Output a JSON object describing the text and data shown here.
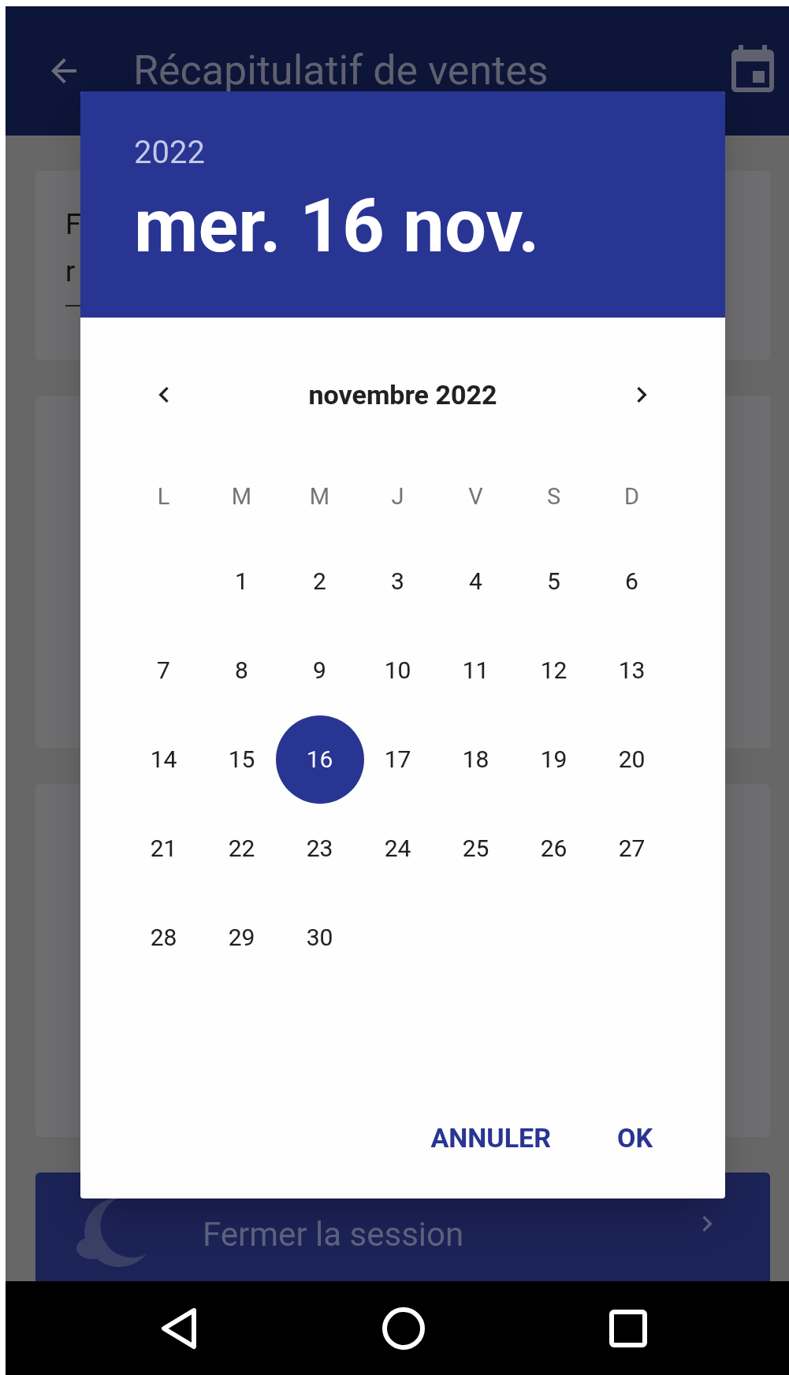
{
  "app_bar": {
    "title": "Récapitulatif de ventes"
  },
  "summary_card": {
    "lines": [
      "F",
      "r"
    ]
  },
  "session_button": {
    "label": "Fermer la session"
  },
  "date_picker": {
    "year": "2022",
    "date": "mer. 16 nov.",
    "month": "novembre 2022",
    "weekdays": [
      "L",
      "M",
      "M",
      "J",
      "V",
      "S",
      "D"
    ],
    "weeks": [
      [
        {
          "label": "1",
          "selected": false
        },
        {
          "label": "2",
          "selected": false
        },
        {
          "label": "3",
          "selected": false
        },
        {
          "label": "4",
          "selected": false
        },
        {
          "label": "5",
          "selected": false
        },
        {
          "label": "6",
          "selected": false
        }
      ],
      [
        {
          "label": "7",
          "selected": false
        },
        {
          "label": "8",
          "selected": false
        },
        {
          "label": "9",
          "selected": false
        },
        {
          "label": "10",
          "selected": false
        },
        {
          "label": "11",
          "selected": false
        },
        {
          "label": "12",
          "selected": false
        },
        {
          "label": "13",
          "selected": false
        }
      ],
      [
        {
          "label": "14",
          "selected": false
        },
        {
          "label": "15",
          "selected": false
        },
        {
          "label": "16",
          "selected": true
        },
        {
          "label": "17",
          "selected": false
        },
        {
          "label": "18",
          "selected": false
        },
        {
          "label": "19",
          "selected": false
        },
        {
          "label": "20",
          "selected": false
        }
      ],
      [
        {
          "label": "21",
          "selected": false
        },
        {
          "label": "22",
          "selected": false
        },
        {
          "label": "23",
          "selected": false
        },
        {
          "label": "24",
          "selected": false
        },
        {
          "label": "25",
          "selected": false
        },
        {
          "label": "26",
          "selected": false
        },
        {
          "label": "27",
          "selected": false
        }
      ],
      [
        {
          "label": "28",
          "selected": false
        },
        {
          "label": "29",
          "selected": false
        },
        {
          "label": "30",
          "selected": false
        }
      ]
    ],
    "buttons": [
      "ANNULER",
      "OK"
    ]
  }
}
